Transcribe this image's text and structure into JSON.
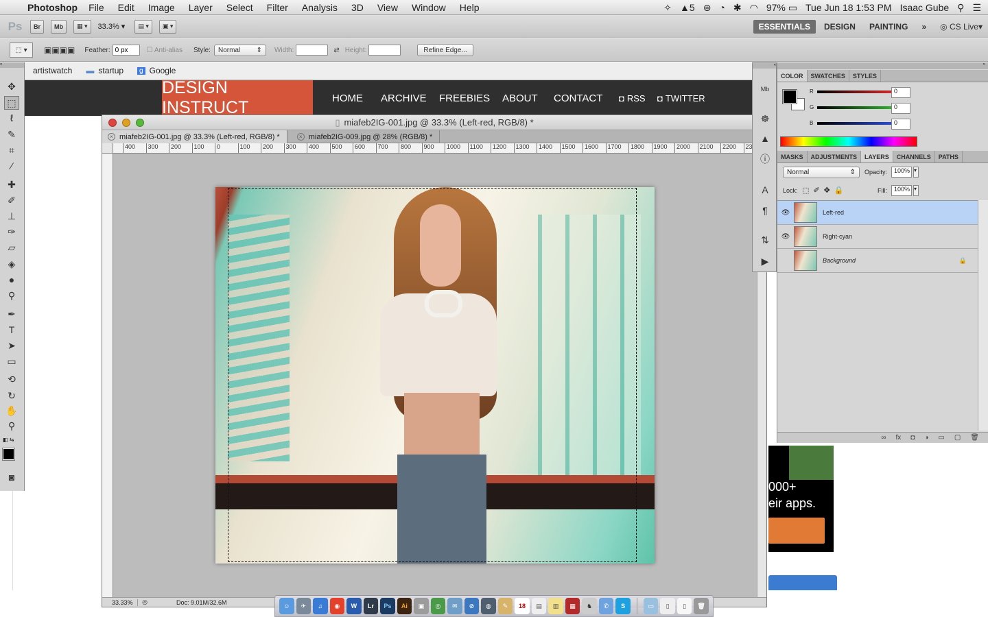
{
  "menubar": {
    "app_name": "Photoshop",
    "items": [
      "File",
      "Edit",
      "Image",
      "Layer",
      "Select",
      "Filter",
      "Analysis",
      "3D",
      "View",
      "Window",
      "Help"
    ],
    "status": {
      "adobe_count": "5",
      "battery": "97%",
      "clock": "Tue Jun 18  1:53 PM",
      "user": "Isaac Gube"
    }
  },
  "appbar": {
    "logo": "Ps",
    "zoom": "33.3%",
    "bridge": "Br",
    "minibridge": "Mb",
    "workspaces": [
      "ESSENTIALS",
      "DESIGN",
      "PAINTING"
    ],
    "cs_live": "CS Live"
  },
  "options": {
    "feather_label": "Feather:",
    "feather_value": "0 px",
    "antialias_label": "Anti-alias",
    "style_label": "Style:",
    "style_value": "Normal",
    "width_label": "Width:",
    "height_label": "Height:",
    "refine_label": "Refine Edge..."
  },
  "browser": {
    "bookmarks": [
      "artistwatch",
      "startup",
      "Google"
    ],
    "site_logo": "DESIGN INSTRUCT",
    "nav": [
      "HOME",
      "ARCHIVE",
      "FREEBIES",
      "ABOUT",
      "CONTACT",
      "RSS",
      "TWITTER"
    ],
    "ad_line1": "000+",
    "ad_line2": "eir apps."
  },
  "document": {
    "title": "miafeb2IG-001.jpg @ 33.3% (Left-red, RGB/8) *",
    "tabs": [
      {
        "label": "miafeb2IG-001.jpg @ 33.3% (Left-red, RGB/8) *"
      },
      {
        "label": "miafeb2IG-009.jpg @ 28% (RGB/8) *"
      }
    ],
    "ruler_ticks": [
      "400",
      "300",
      "200",
      "100",
      "0",
      "100",
      "200",
      "300",
      "400",
      "500",
      "600",
      "700",
      "800",
      "900",
      "1000",
      "1100",
      "1200",
      "1300",
      "1400",
      "1500",
      "1600",
      "1700",
      "1800",
      "1900",
      "2000",
      "2100",
      "2200",
      "23"
    ],
    "status_zoom": "33.33%",
    "status_doc": "Doc: 9.01M/32.6M"
  },
  "color_panel": {
    "tabs": [
      "COLOR",
      "SWATCHES",
      "STYLES"
    ],
    "channels": [
      {
        "label": "R",
        "value": "0",
        "color": "#e03030"
      },
      {
        "label": "G",
        "value": "0",
        "color": "#30c030"
      },
      {
        "label": "B",
        "value": "0",
        "color": "#3050e0"
      }
    ]
  },
  "layers_panel": {
    "tabs": [
      "MASKS",
      "ADJUSTMENTS",
      "LAYERS",
      "CHANNELS",
      "PATHS"
    ],
    "blend_mode": "Normal",
    "opacity_label": "Opacity:",
    "opacity_value": "100%",
    "lock_label": "Lock:",
    "fill_label": "Fill:",
    "fill_value": "100%",
    "layers": [
      {
        "name": "Left-red",
        "visible": true,
        "selected": true
      },
      {
        "name": "Right-cyan",
        "visible": true,
        "selected": false
      },
      {
        "name": "Background",
        "visible": false,
        "selected": false,
        "locked": true
      }
    ]
  },
  "dock": {
    "apps": [
      "Finder",
      "Rocket",
      "iTunes",
      "Chrome",
      "Word",
      "Lr",
      "Ps",
      "Ai",
      "Preview",
      "Maps",
      "Mail",
      "Safari",
      "Steam",
      "Calendar",
      "Notes",
      "Stickies",
      "Chess",
      "Capture",
      "Messages",
      "Skype"
    ],
    "calendar_day": "18"
  }
}
